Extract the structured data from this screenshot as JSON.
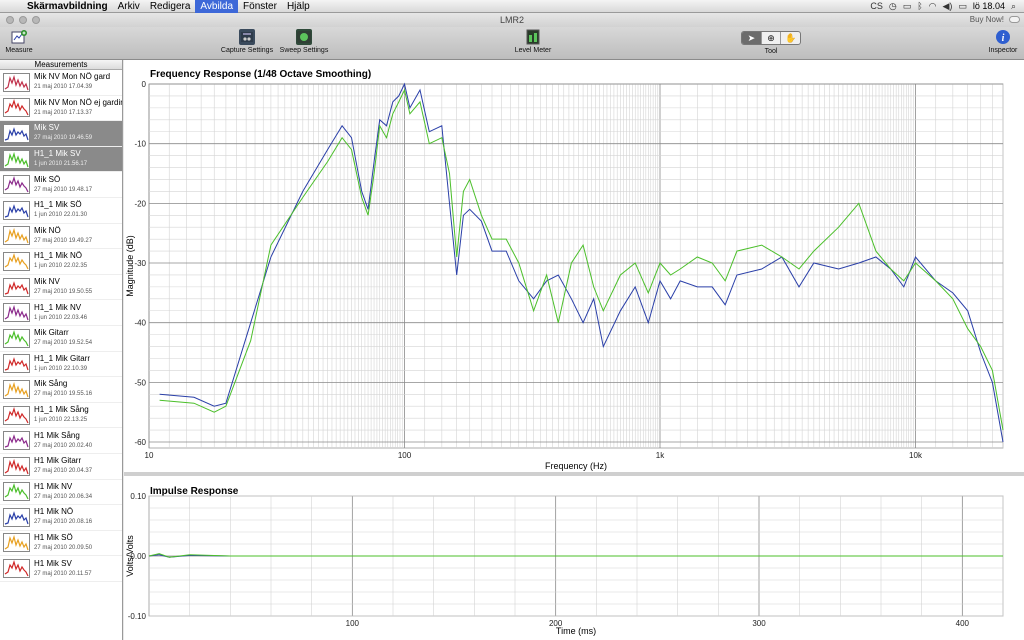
{
  "menubar": {
    "app": "Skärmavbildning",
    "items": [
      "Arkiv",
      "Redigera",
      "Avbilda",
      "Fönster",
      "Hjälp"
    ],
    "active_item": "Avbilda",
    "clock": "lö 18.04"
  },
  "window": {
    "title": "LMR2",
    "buy_now": "Buy Now!"
  },
  "toolbar": {
    "measure": "Measure",
    "capture_settings": "Capture Settings",
    "sweep_settings": "Sweep Settings",
    "level_meter": "Level Meter",
    "tool": "Tool",
    "inspector": "Inspector"
  },
  "sidebar": {
    "header": "Measurements",
    "items": [
      {
        "name": "Mik NV Mon NÖ gard",
        "date": "21 maj 2010 17.04.39",
        "color": "#c0304a"
      },
      {
        "name": "Mik NV Mon NÖ ej gardin",
        "date": "21 maj 2010 17.13.37",
        "color": "#d02828"
      },
      {
        "name": "Mik SV",
        "date": "27 maj 2010 19.46.59",
        "color": "#2a3fa8",
        "selected": true
      },
      {
        "name": "H1_1 Mik SV",
        "date": "1 jun 2010 21.56.17",
        "color": "#4bbf2a",
        "selected": true
      },
      {
        "name": "Mik SÖ",
        "date": "27 maj 2010 19.48.17",
        "color": "#8b2a8b"
      },
      {
        "name": "H1_1 Mik SÖ",
        "date": "1 jun 2010 22.01.30",
        "color": "#2a3fa8"
      },
      {
        "name": "Mik NÖ",
        "date": "27 maj 2010 19.49.27",
        "color": "#e8a020"
      },
      {
        "name": "H1_1 Mik NÖ",
        "date": "1 jun 2010 22.02.35",
        "color": "#e8a020"
      },
      {
        "name": "Mik NV",
        "date": "27 maj 2010 19.50.55",
        "color": "#d02828"
      },
      {
        "name": "H1_1 Mik NV",
        "date": "1 jun 2010 22.03.46",
        "color": "#8b2a8b"
      },
      {
        "name": "Mik Gitarr",
        "date": "27 maj 2010 19.52.54",
        "color": "#4bbf2a"
      },
      {
        "name": "H1_1 Mik Gitarr",
        "date": "1 jun 2010 22.10.39",
        "color": "#d02828"
      },
      {
        "name": "Mik Sång",
        "date": "27 maj 2010 19.55.16",
        "color": "#e8a020"
      },
      {
        "name": "H1_1 Mik Sång",
        "date": "1 jun 2010 22.13.25",
        "color": "#d02828"
      },
      {
        "name": "H1 Mik Sång",
        "date": "27 maj 2010 20.02.40",
        "color": "#8b2a8b"
      },
      {
        "name": "H1 Mik Gitarr",
        "date": "27 maj 2010 20.04.37",
        "color": "#d02828"
      },
      {
        "name": "H1 Mik NV",
        "date": "27 maj 2010 20.06.34",
        "color": "#4bbf2a"
      },
      {
        "name": "H1 Mik NÖ",
        "date": "27 maj 2010 20.08.16",
        "color": "#2a3fa8"
      },
      {
        "name": "H1 Mik SÖ",
        "date": "27 maj 2010 20.09.50",
        "color": "#e8a020"
      },
      {
        "name": "H1 Mik SV",
        "date": "27 maj 2010 20.11.57",
        "color": "#d02828"
      }
    ]
  },
  "chart_data": [
    {
      "type": "line",
      "title": "Frequency Response (1/48 Octave Smoothing)",
      "xlabel": "Frequency (Hz)",
      "ylabel": "Magnitude (dB)",
      "xscale": "log",
      "xlim": [
        10,
        22000
      ],
      "ylim": [
        -61,
        0
      ],
      "x_ticks": [
        "10",
        "100",
        "1k",
        "10k"
      ],
      "y_ticks": [
        "0",
        "-10",
        "-20",
        "-30",
        "-40",
        "-50",
        "-60"
      ],
      "grid": true,
      "series": [
        {
          "color": "#2a3fa8",
          "x": [
            11,
            15,
            18,
            20,
            25,
            30,
            40,
            50,
            57,
            62,
            68,
            72,
            76,
            80,
            85,
            90,
            95,
            100,
            105,
            115,
            125,
            140,
            150,
            160,
            170,
            180,
            200,
            220,
            250,
            280,
            320,
            360,
            400,
            450,
            500,
            550,
            600,
            700,
            800,
            900,
            1000,
            1100,
            1200,
            1400,
            1600,
            1800,
            2000,
            2500,
            3000,
            3500,
            4000,
            5000,
            6000,
            7000,
            8000,
            9000,
            10000,
            12000,
            14000,
            16000,
            18000,
            20000,
            22000
          ],
          "y": [
            -52,
            -52.5,
            -54,
            -53.5,
            -40,
            -29,
            -18,
            -11,
            -7,
            -9,
            -18,
            -21,
            -13,
            -6,
            -7,
            -3,
            -2,
            0,
            -4,
            -1,
            -8,
            -7,
            -20,
            -32,
            -22,
            -21,
            -23,
            -28,
            -28,
            -33,
            -36,
            -33,
            -32,
            -36,
            -40,
            -36,
            -44,
            -38,
            -34,
            -40,
            -33,
            -36,
            -33,
            -34,
            -34,
            -37,
            -32,
            -31,
            -29,
            -34,
            -30,
            -31,
            -30,
            -29,
            -31,
            -34,
            -29,
            -33,
            -35,
            -38,
            -45,
            -50,
            -60
          ]
        },
        {
          "color": "#4bbf2a",
          "x": [
            11,
            15,
            18,
            20,
            25,
            30,
            40,
            50,
            57,
            62,
            68,
            72,
            76,
            80,
            85,
            90,
            95,
            100,
            105,
            115,
            125,
            140,
            150,
            160,
            170,
            180,
            200,
            220,
            250,
            280,
            320,
            360,
            400,
            450,
            500,
            550,
            600,
            700,
            800,
            900,
            1000,
            1100,
            1200,
            1400,
            1600,
            1800,
            2000,
            2500,
            3000,
            3500,
            4000,
            5000,
            6000,
            7000,
            8000,
            9000,
            10000,
            12000,
            14000,
            16000,
            18000,
            20000,
            22000
          ],
          "y": [
            -53,
            -53.5,
            -55,
            -54,
            -43,
            -27,
            -19,
            -13,
            -9,
            -11,
            -19,
            -22,
            -15,
            -7,
            -9,
            -5,
            -3,
            -1,
            -5,
            -3,
            -10,
            -9,
            -15,
            -29,
            -18,
            -16,
            -22,
            -26,
            -26,
            -30,
            -38,
            -32,
            -40,
            -30,
            -27,
            -34,
            -38,
            -32,
            -30,
            -35,
            -30,
            -32,
            -31,
            -29,
            -30,
            -33,
            -28,
            -27,
            -29,
            -31,
            -28,
            -24,
            -20,
            -28,
            -31,
            -33,
            -30,
            -33,
            -36,
            -41,
            -44,
            -48,
            -58
          ]
        }
      ]
    },
    {
      "type": "line",
      "title": "Impulse Response",
      "xlabel": "Time (ms)",
      "ylabel": "Volts/Volts",
      "xlim": [
        0,
        420
      ],
      "ylim": [
        -0.1,
        0.1
      ],
      "x_ticks": [
        "100",
        "200",
        "300",
        "400"
      ],
      "y_ticks": [
        "0.10",
        "0.00",
        "-0.10"
      ],
      "grid": true,
      "series": [
        {
          "color": "#2a3fa8",
          "x": [
            0,
            5,
            10,
            20,
            40,
            420
          ],
          "y": [
            0.0,
            0.002,
            -0.002,
            0.001,
            0.0,
            0.0
          ]
        },
        {
          "color": "#4bbf2a",
          "x": [
            0,
            5,
            10,
            20,
            40,
            420
          ],
          "y": [
            0.0,
            0.004,
            -0.002,
            0.002,
            0.0,
            0.0
          ]
        }
      ]
    }
  ]
}
